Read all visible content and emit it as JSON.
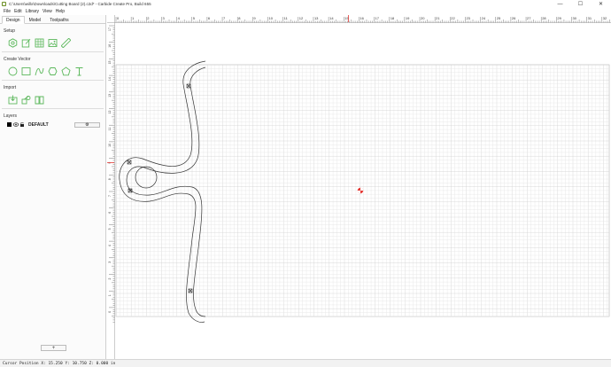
{
  "window": {
    "title": "C:\\Users\\willx\\Downloads\\Cutting Board (2).c2d* - Carbide Create Pro, Build 655",
    "controls": [
      "—",
      "☐",
      "✕"
    ]
  },
  "menu": [
    "File",
    "Edit",
    "Library",
    "View",
    "Help"
  ],
  "tabs": [
    "Design",
    "Model",
    "Toolpaths"
  ],
  "active_tab": "Design",
  "sections": {
    "setup": "Setup",
    "create_vector": "Create Vector",
    "import": "Import",
    "layers": "Layers"
  },
  "icons": {
    "setup": [
      "settings-hex-icon",
      "edit-document-icon",
      "grid-icon",
      "image-icon",
      "ruler-icon"
    ],
    "create_vector": [
      "circle-icon",
      "rectangle-icon",
      "curve-icon",
      "polygon-icon",
      "pentagon-icon",
      "text-icon"
    ],
    "import": [
      "import-svg-icon",
      "import-image-icon",
      "library-book-icon"
    ]
  },
  "layers": [
    {
      "name": "DEFAULT",
      "color": "#000000",
      "settings": "⚙"
    }
  ],
  "add_layer_label": "+",
  "ruler": {
    "x_labels": [
      "0",
      "1",
      "2",
      "3",
      "4",
      "5",
      "6",
      "7",
      "8",
      "9",
      "10",
      "11",
      "12",
      "13",
      "14",
      "15",
      "16",
      "17",
      "18",
      "19",
      "20",
      "21",
      "22",
      "23",
      "24",
      "25",
      "26",
      "27",
      "28",
      "29",
      "30",
      "31",
      "32"
    ],
    "y_labels": [
      "17",
      "16",
      "15",
      "14",
      "13",
      "12",
      "11",
      "10",
      "9",
      "8",
      "7",
      "6",
      "5",
      "4",
      "3",
      "2",
      "1",
      "0"
    ]
  },
  "status": {
    "text": "Cursor Position X: 15.250 Y: 10.750 Z: 0.000 in"
  },
  "colors": {
    "accent_green": "#5cb85c",
    "grid_line": "#e4e4e4",
    "grid_major": "#cfcfcf",
    "ruler_marker": "#e53935",
    "origin_marker": "#e53935"
  }
}
